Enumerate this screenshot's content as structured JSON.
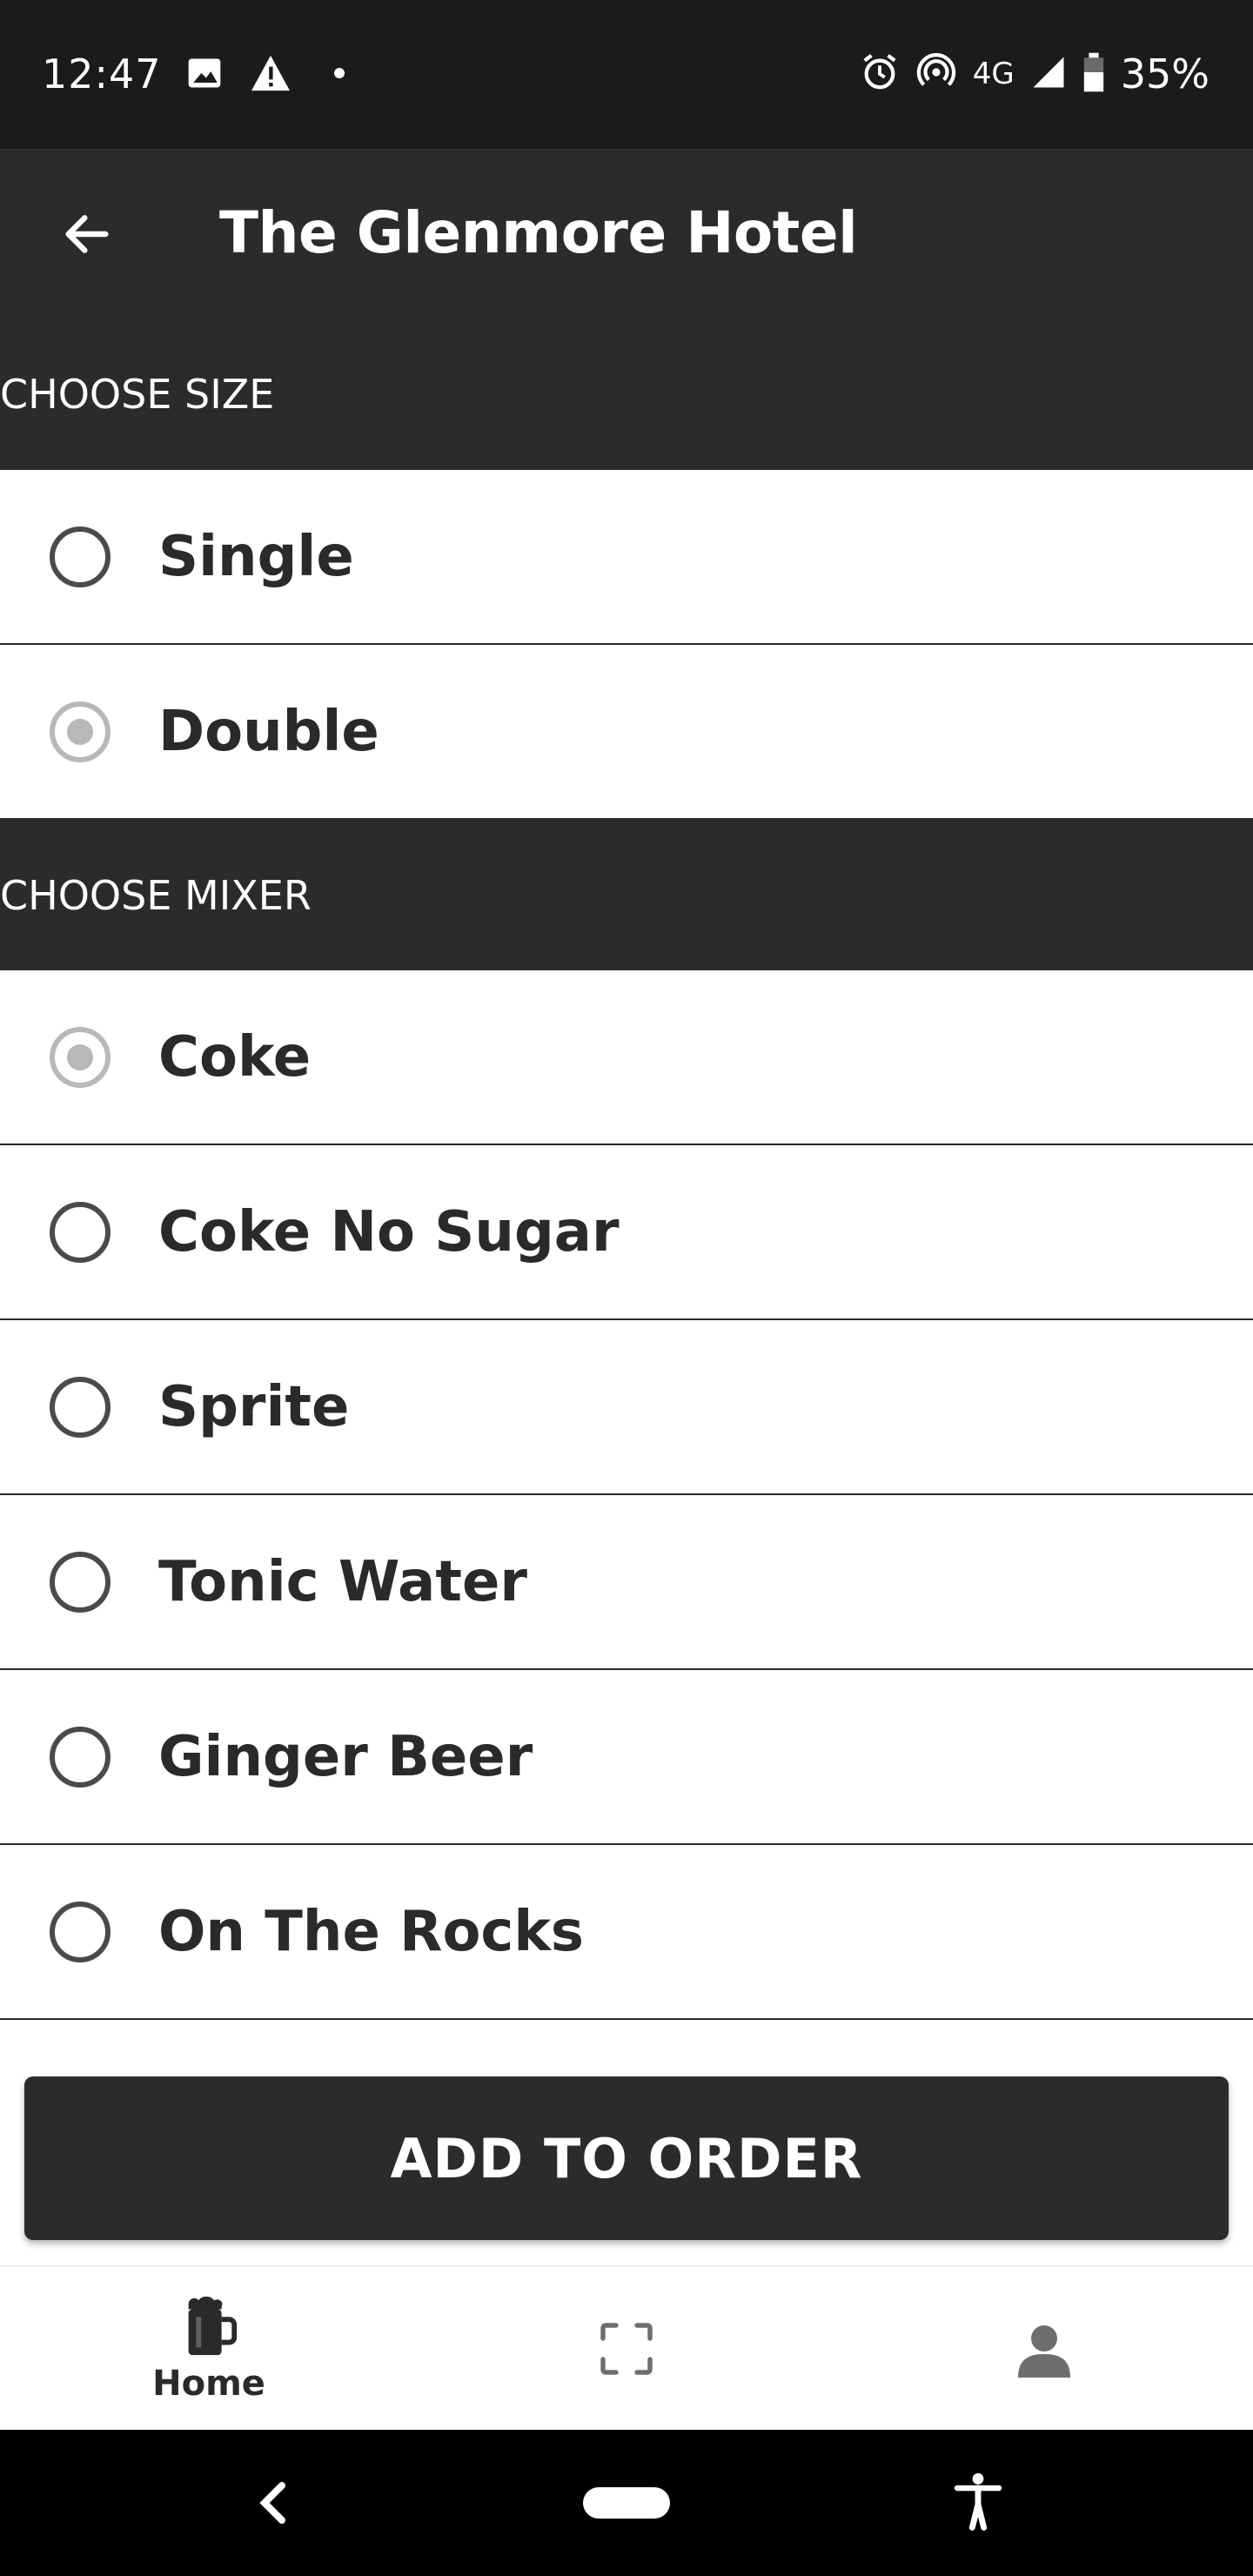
{
  "status_bar": {
    "time": "12:47",
    "network": "4G",
    "battery": "35%",
    "icons": [
      "image-icon",
      "warning-icon",
      "dot-icon",
      "alarm-icon",
      "hotspot-icon",
      "signal-icon",
      "battery-icon"
    ]
  },
  "app_bar": {
    "title": "The Glenmore Hotel",
    "back_icon": "arrow-back-icon"
  },
  "size_section": {
    "header": "CHOOSE SIZE",
    "options": [
      {
        "label": "Single",
        "selected": false
      },
      {
        "label": "Double",
        "selected": true
      }
    ]
  },
  "mixer_section": {
    "header": "CHOOSE MIXER",
    "options": [
      {
        "label": "Coke",
        "selected": true
      },
      {
        "label": "Coke No Sugar",
        "selected": false
      },
      {
        "label": "Sprite",
        "selected": false
      },
      {
        "label": "Tonic Water",
        "selected": false
      },
      {
        "label": "Ginger Beer",
        "selected": false
      },
      {
        "label": "On The Rocks",
        "selected": false
      }
    ]
  },
  "add_button": {
    "label": "ADD TO ORDER"
  },
  "bottom_nav": {
    "items": [
      {
        "label": "Home",
        "icon": "beer-mug-icon",
        "active": true
      },
      {
        "label": "",
        "icon": "scan-icon",
        "active": false
      },
      {
        "label": "",
        "icon": "profile-icon",
        "active": false
      }
    ]
  },
  "colors": {
    "dark_bar": "#2b2b2b",
    "status_bar": "#1b1b1b",
    "radio_selected": "#b8b8b8",
    "radio_unselected": "#4a4a4a"
  }
}
